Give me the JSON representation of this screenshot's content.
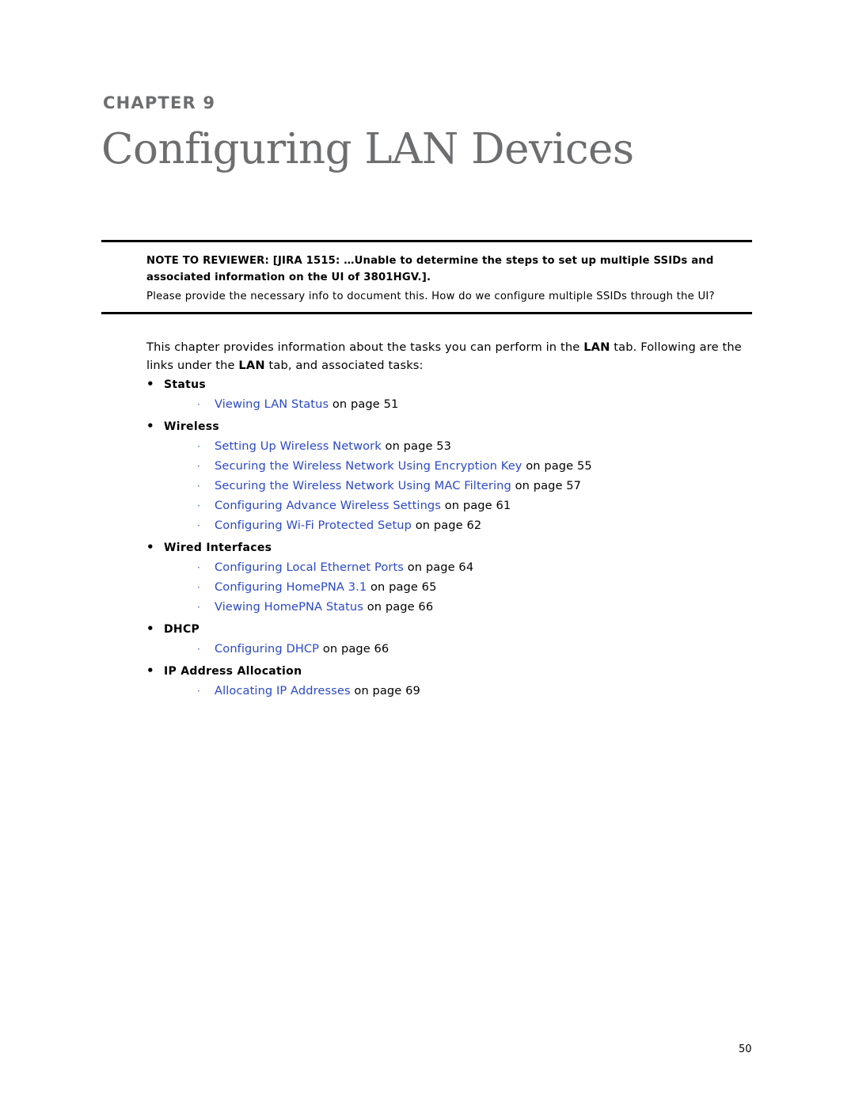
{
  "chapter": {
    "label": "CHAPTER 9",
    "title": "Configuring LAN Devices"
  },
  "reviewer_note": {
    "heading": "NOTE TO REVIEWER: [JIRA 1515: …Unable to determine the steps to set up multiple SSIDs and associated information on the UI of 3801HGV.].",
    "body": "Please provide the necessary info to document this. How do we configure multiple SSIDs through the UI?"
  },
  "intro": {
    "part1": "This chapter provides information about the tasks you can perform in the ",
    "bold1": "LAN",
    "part2": " tab. Following are the links under the ",
    "bold2": "LAN",
    "part3": " tab, and associated tasks:"
  },
  "bullets": {
    "level1_glyph": "•",
    "level2_glyph": "·"
  },
  "sections": [
    {
      "label": "Status",
      "items": [
        {
          "link": "Viewing LAN Status",
          "tail": " on page 51"
        }
      ]
    },
    {
      "label": "Wireless",
      "items": [
        {
          "link": "Setting Up Wireless Network",
          "tail": " on page 53"
        },
        {
          "link": "Securing the Wireless Network Using Encryption Key",
          "tail": " on page 55"
        },
        {
          "link": "Securing the Wireless Network Using MAC Filtering",
          "tail": " on page 57"
        },
        {
          "link": "Configuring Advance Wireless Settings",
          "tail": " on page 61"
        },
        {
          "link": "Configuring Wi-Fi Protected Setup",
          "tail": " on page 62"
        }
      ]
    },
    {
      "label": "Wired Interfaces",
      "items": [
        {
          "link": "Configuring Local Ethernet Ports",
          "tail": " on page 64"
        },
        {
          "link": "Configuring HomePNA 3.1",
          "tail": " on page 65"
        },
        {
          "link": "Viewing HomePNA Status",
          "tail": " on page 66"
        }
      ]
    },
    {
      "label": "DHCP",
      "items": [
        {
          "link": "Configuring DHCP",
          "tail": " on page 66"
        }
      ]
    },
    {
      "label": "IP Address Allocation",
      "items": [
        {
          "link": "Allocating IP Addresses",
          "tail": " on page 69"
        }
      ]
    }
  ],
  "footer": {
    "page_number": "50"
  },
  "colors": {
    "heading_gray": "#6d6e70",
    "link_blue": "#2b49c7"
  }
}
